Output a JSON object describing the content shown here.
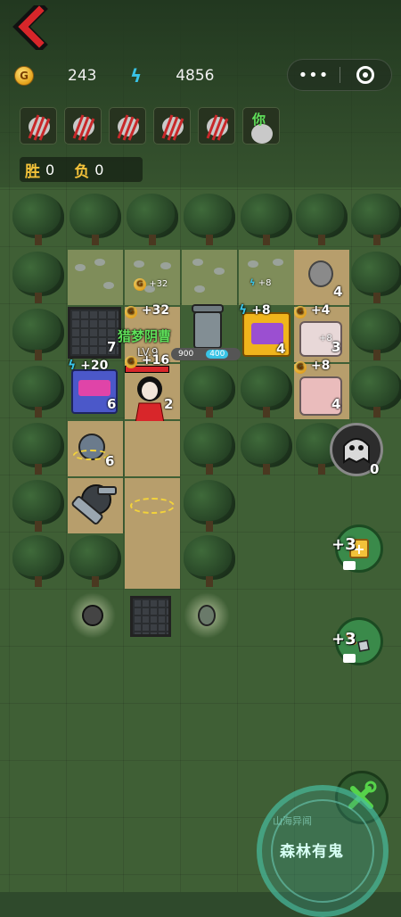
{
  "header": {
    "gold_icon_letter": "G",
    "gold": "243",
    "energy": "4856",
    "menu_dots": "•••"
  },
  "players": {
    "you_label": "你",
    "count": 6
  },
  "score": {
    "win_label": "胜",
    "win": "0",
    "loss_label": "负",
    "loss": "0"
  },
  "board": {
    "field_bonus_1": "+32",
    "field_bonus_2": "+8",
    "field_count": "4",
    "door_count": "7",
    "gold_plus_32": "+32",
    "energy_plus_8": "+8",
    "gold_plus_4": "+4",
    "player_name": "猎梦阴曹",
    "player_level": "LV.9",
    "bar_left": "900",
    "bar_right": "400",
    "machine_count": "4",
    "bed1_count": "3",
    "bed1_bonus": "+8",
    "gold_plus_8": "+8",
    "bed2_count": "4",
    "energy_plus_20": "+20",
    "gold_plus_16": "+16",
    "arcade_count": "6",
    "girl_count": "2",
    "turret_count": "6"
  },
  "side": {
    "ghost_count": "0",
    "build_bonus": "+3",
    "shovel_bonus": "+3"
  },
  "stamp": {
    "title": "森林有鬼",
    "arc": "山海异闻"
  },
  "colors": {
    "gold": "#e3a21a",
    "energy": "#39c3e6",
    "name_green": "#5fe05a",
    "back_red": "#d8262a"
  }
}
